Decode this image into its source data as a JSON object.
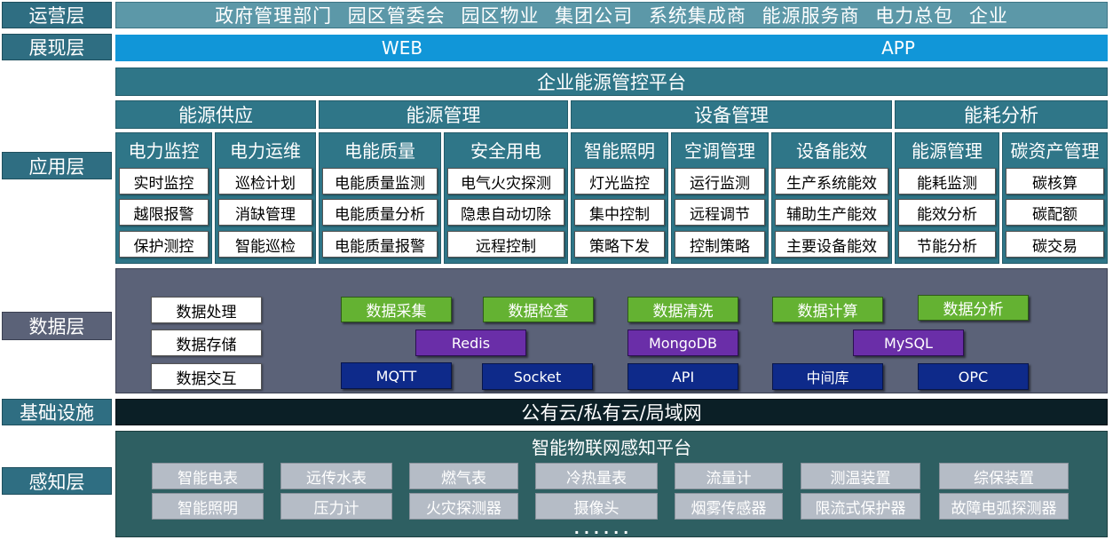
{
  "layers": {
    "ops": "运营层",
    "presentation": "展现层",
    "application": "应用层",
    "data": "数据层",
    "infrastructure": "基础设施",
    "perception": "感知层"
  },
  "ops_bar": "政府管理部门 园区管委会 园区物业 集团公司 系统集成商 能源服务商 电力总包 企业",
  "presentation": {
    "web": "WEB",
    "app": "APP"
  },
  "platform_title": "企业能源管控平台",
  "categories": [
    "能源供应",
    "能源管理",
    "设备管理",
    "能耗分析"
  ],
  "modules": [
    {
      "title": "电力监控",
      "items": [
        "实时监控",
        "越限报警",
        "保护测控"
      ]
    },
    {
      "title": "电力运维",
      "items": [
        "巡检计划",
        "消缺管理",
        "智能巡检"
      ]
    },
    {
      "title": "电能质量",
      "items": [
        "电能质量监测",
        "电能质量分析",
        "电能质量报警"
      ]
    },
    {
      "title": "安全用电",
      "items": [
        "电气火灾探测",
        "隐患自动切除",
        "远程控制"
      ]
    },
    {
      "title": "智能照明",
      "items": [
        "灯光监控",
        "集中控制",
        "策略下发"
      ]
    },
    {
      "title": "空调管理",
      "items": [
        "运行监测",
        "远程调节",
        "控制策略"
      ]
    },
    {
      "title": "设备能效",
      "items": [
        "生产系统能效",
        "辅助生产能效",
        "主要设备能效"
      ]
    },
    {
      "title": "能源管理",
      "items": [
        "能耗监测",
        "能效分析",
        "节能分析"
      ]
    },
    {
      "title": "碳资产管理",
      "items": [
        "碳核算",
        "碳配额",
        "碳交易"
      ]
    }
  ],
  "data_layer": {
    "left": [
      "数据处理",
      "数据存储",
      "数据交互"
    ],
    "processes": [
      "数据采集",
      "数据检查",
      "数据清洗",
      "数据计算",
      "数据分析"
    ],
    "databases": [
      "Redis",
      "MongoDB",
      "MySQL"
    ],
    "protocols": [
      "MQTT",
      "Socket",
      "API",
      "中间库",
      "OPC"
    ]
  },
  "infrastructure_bar": "公有云/私有云/局域网",
  "perception": {
    "title": "智能物联网感知平台",
    "row1": [
      "智能电表",
      "远传水表",
      "燃气表",
      "冷热量表",
      "流量计",
      "测温装置",
      "综保装置"
    ],
    "row2": [
      "智能照明",
      "压力计",
      "火灾探测器",
      "摄像头",
      "烟雾传感器",
      "限流式保护器",
      "故障电弧探测器"
    ],
    "more": "......"
  },
  "colors": {
    "teal": "#2f7688",
    "blue": "#1196d8",
    "data_panel": "#5b6278",
    "green": "#64b232",
    "purple": "#6a2ea8",
    "navy": "#0e2a8a",
    "infra_bar": "#0b1f26",
    "perception_panel": "#2e5f62",
    "sensor_gray": "#b5bcc6"
  }
}
